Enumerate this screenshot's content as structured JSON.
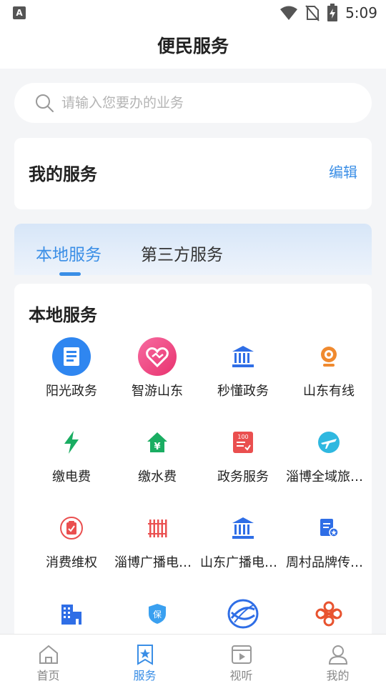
{
  "status_bar": {
    "left_indicator": "A",
    "time": "5:09"
  },
  "header": {
    "title": "便民服务"
  },
  "search": {
    "placeholder": "请输入您要办的业务"
  },
  "my_service": {
    "title": "我的服务",
    "edit_label": "编辑"
  },
  "tabs": [
    {
      "label": "本地服务",
      "active": true
    },
    {
      "label": "第三方服务",
      "active": false
    }
  ],
  "local": {
    "title": "本地服务",
    "items": [
      {
        "label": "阳光政务",
        "icon": "document-circle-icon"
      },
      {
        "label": "智游山东",
        "icon": "heart-circle-icon"
      },
      {
        "label": "秒懂政务",
        "icon": "government-building-icon"
      },
      {
        "label": "山东有线",
        "icon": "webcam-icon"
      },
      {
        "label": "缴电费",
        "icon": "lightning-icon"
      },
      {
        "label": "缴水费",
        "icon": "house-yuan-icon"
      },
      {
        "label": "政务服务",
        "icon": "checklist-100-icon"
      },
      {
        "label": "淄博全域旅游...",
        "icon": "plane-globe-icon"
      },
      {
        "label": "消费维权",
        "icon": "clipboard-check-icon"
      },
      {
        "label": "淄博广播电视...",
        "icon": "radiator-icon"
      },
      {
        "label": "山东广播电视...",
        "icon": "government-building-icon"
      },
      {
        "label": "周村品牌传播...",
        "icon": "document-badge-icon"
      },
      {
        "label": "",
        "icon": "city-buildings-icon"
      },
      {
        "label": "",
        "icon": "shield-bao-icon"
      },
      {
        "label": "",
        "icon": "china-mobile-logo-icon"
      },
      {
        "label": "",
        "icon": "china-unicom-logo-icon"
      }
    ]
  },
  "bottom_nav": [
    {
      "label": "首页",
      "icon": "home-icon",
      "active": false
    },
    {
      "label": "服务",
      "icon": "bookmark-star-icon",
      "active": true
    },
    {
      "label": "视听",
      "icon": "video-play-icon",
      "active": false
    },
    {
      "label": "我的",
      "icon": "user-icon",
      "active": false
    }
  ],
  "colors": {
    "accent": "#3a8ee6",
    "background": "#f4f5f7",
    "tab_gradient_top": "#d7e6f8"
  }
}
